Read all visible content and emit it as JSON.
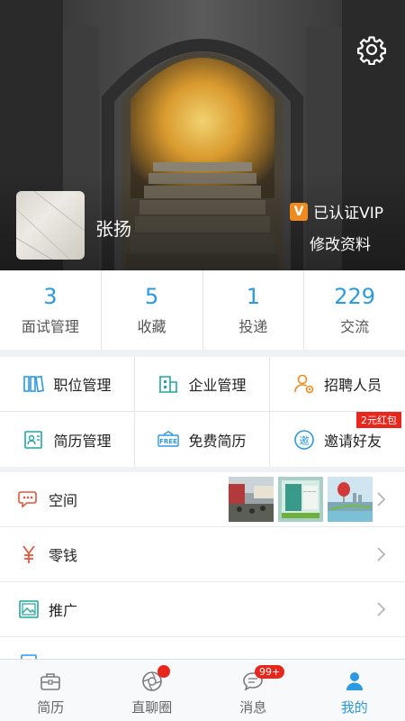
{
  "profile": {
    "name": "张扬",
    "vip_badge": "V",
    "vip_text": "已认证VIP",
    "edit_label": "修改资料"
  },
  "stats": [
    {
      "value": "3",
      "label": "面试管理"
    },
    {
      "value": "5",
      "label": "收藏"
    },
    {
      "value": "1",
      "label": "投递"
    },
    {
      "value": "229",
      "label": "交流"
    }
  ],
  "grid": [
    {
      "label": "职位管理",
      "icon": "job-icon"
    },
    {
      "label": "企业管理",
      "icon": "company-icon"
    },
    {
      "label": "招聘人员",
      "icon": "recruiter-icon"
    },
    {
      "label": "简历管理",
      "icon": "resume-icon"
    },
    {
      "label": "免费简历",
      "icon": "free-icon"
    },
    {
      "label": "邀请好友",
      "icon": "invite-icon",
      "badge": "2元红包"
    }
  ],
  "list": [
    {
      "label": "空间",
      "icon": "chat-icon"
    },
    {
      "label": "零钱",
      "icon": "yen-icon"
    },
    {
      "label": "推广",
      "icon": "picture-icon"
    }
  ],
  "nav": [
    {
      "label": "简历",
      "icon": "briefcase-icon"
    },
    {
      "label": "直聊圈",
      "icon": "aperture-icon"
    },
    {
      "label": "消息",
      "icon": "message-icon",
      "badge": "99+"
    },
    {
      "label": "我的",
      "icon": "person-icon"
    }
  ],
  "colors": {
    "accent": "#2a9be3",
    "red": "#e8261c",
    "vip": "#f08a1c"
  }
}
